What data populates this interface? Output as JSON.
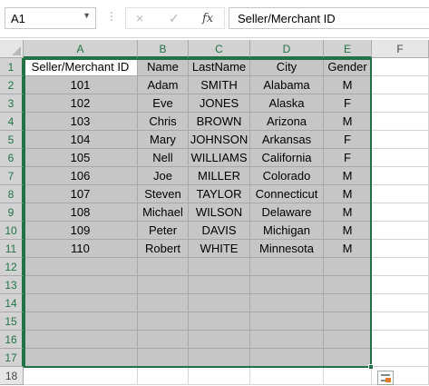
{
  "name_box": {
    "value": "A1"
  },
  "formula_bar": {
    "content": "Seller/Merchant ID",
    "cancel_icon": "×",
    "enter_icon": "✓",
    "fx_icon": "fx"
  },
  "columns": [
    "A",
    "B",
    "C",
    "D",
    "E",
    "F"
  ],
  "rows": [
    "1",
    "2",
    "3",
    "4",
    "5",
    "6",
    "7",
    "8",
    "9",
    "10",
    "11",
    "12",
    "13",
    "14",
    "15",
    "16",
    "17",
    "18"
  ],
  "table": {
    "headers": [
      "Seller/Merchant ID",
      "Name",
      "LastName",
      "City",
      "Gender"
    ],
    "rows": [
      [
        "101",
        "Adam",
        "SMITH",
        "Alabama",
        "M"
      ],
      [
        "102",
        "Eve",
        "JONES",
        "Alaska",
        "F"
      ],
      [
        "103",
        "Chris",
        "BROWN",
        "Arizona",
        "M"
      ],
      [
        "104",
        "Mary",
        "JOHNSON",
        "Arkansas",
        "F"
      ],
      [
        "105",
        "Nell",
        "WILLIAMS",
        "California",
        "F"
      ],
      [
        "106",
        "Joe",
        "MILLER",
        "Colorado",
        "M"
      ],
      [
        "107",
        "Steven",
        "TAYLOR",
        "Connecticut",
        "M"
      ],
      [
        "108",
        "Michael",
        "WILSON",
        "Delaware",
        "M"
      ],
      [
        "109",
        "Peter",
        "DAVIS",
        "Michigan",
        "M"
      ],
      [
        "110",
        "Robert",
        "WHITE",
        "Minnesota",
        "M"
      ]
    ]
  },
  "colors": {
    "accent": "#217346",
    "selection": "#c6c6c6"
  }
}
